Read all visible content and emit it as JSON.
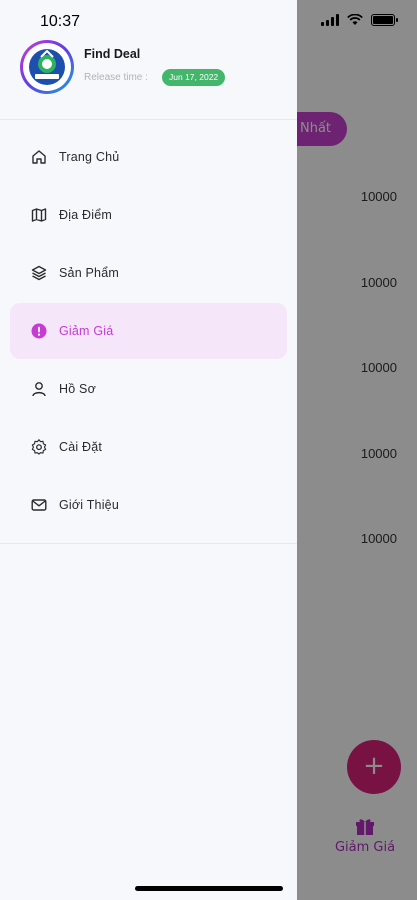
{
  "status_bar": {
    "time": "10:37"
  },
  "background": {
    "pill_label": "Nhất",
    "values": [
      "10000",
      "10000",
      "10000",
      "10000",
      "10000"
    ],
    "fab_label": "+",
    "tab_label": "Giảm Giá"
  },
  "drawer": {
    "app_name": "Find Deal",
    "release_label": "Release time :",
    "release_date": "Jun 17, 2022",
    "items": [
      {
        "label": "Trang Chủ",
        "icon": "home-icon"
      },
      {
        "label": "Địa Điểm",
        "icon": "map-icon"
      },
      {
        "label": "Sản Phẩm",
        "icon": "layers-icon"
      },
      {
        "label": "Giảm Giá",
        "icon": "discount-icon",
        "active": true
      },
      {
        "label": "Hồ Sơ",
        "icon": "user-icon"
      },
      {
        "label": "Cài Đặt",
        "icon": "settings-icon"
      },
      {
        "label": "Giới Thiệu",
        "icon": "mail-icon"
      }
    ]
  },
  "colors": {
    "accent": "#c53bd3",
    "active_bg": "#f5e6fa",
    "badge_green": "#43b66b",
    "fab": "#d9217b"
  }
}
